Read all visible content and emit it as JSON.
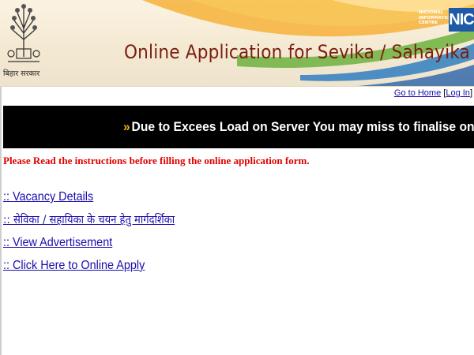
{
  "header": {
    "emblem_caption": "बिहार सरकार",
    "title": "Online Application for Sevika / Sahayika",
    "nic_text": "NATIONAL INFORMATICS CENTRE",
    "nic_logo": "NIC"
  },
  "toplinks": {
    "open": "",
    "home": "Go to Home",
    "separator": " [",
    "login": "Log In",
    "close": "]"
  },
  "announcement": {
    "icon": "double-arrow-icon",
    "text": "Due to Excees Load on Server You may miss to finalise on Last Day so do"
  },
  "instruction": "Please Read the instructions before filling the online application form.",
  "links": [
    {
      "label": ":: Vacancy Details "
    },
    {
      "label": ":: सेविका / सहायिका के चयन हेतु मार्गदर्शिका "
    },
    {
      "label": ":: View Advertisement "
    },
    {
      "label": ":: Click Here to Online Apply "
    }
  ],
  "colors": {
    "title": "#7a1e10",
    "instruction": "#e00000",
    "link": "#1a0dab",
    "marquee_bg": "#000000",
    "nic_blue": "#1e5aa8"
  }
}
